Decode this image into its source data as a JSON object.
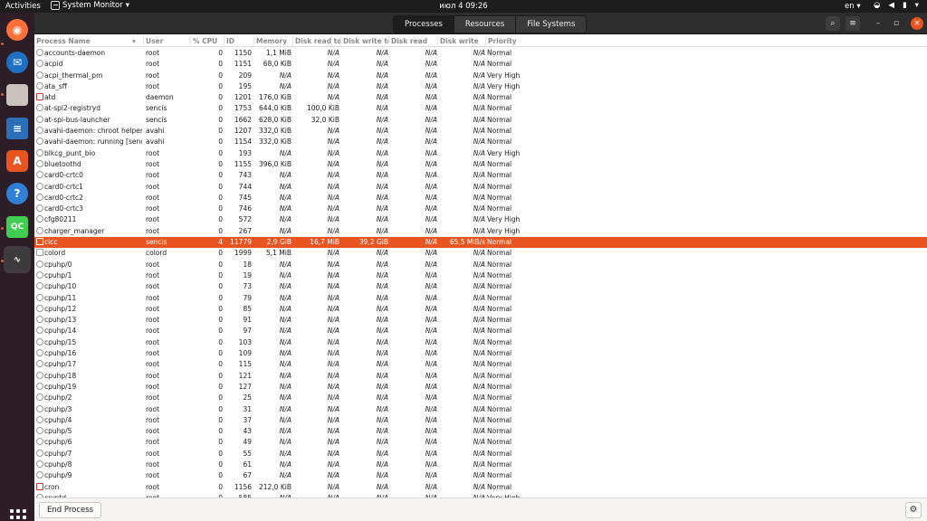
{
  "topbar": {
    "activities": "Activities",
    "app_name": "System Monitor",
    "clock": "июл 4  09:26",
    "lang": "en"
  },
  "dock": {
    "items": [
      {
        "name": "firefox",
        "icon": "firefox-icon",
        "color": "#ff7139"
      },
      {
        "name": "thunderbird",
        "icon": "thunderbird-icon",
        "color": "#1f6fc5"
      },
      {
        "name": "files",
        "icon": "folder-icon",
        "color": "#c9c3bb"
      },
      {
        "name": "writer",
        "icon": "document-icon",
        "color": "#2a6fb8"
      },
      {
        "name": "software",
        "icon": "software-icon",
        "color": "#e95420"
      },
      {
        "name": "help",
        "icon": "help-icon",
        "color": "#2f7fd6"
      },
      {
        "name": "qtcreator",
        "icon": "qc-icon",
        "color": "#41cd52"
      },
      {
        "name": "system-monitor",
        "icon": "monitor-icon",
        "color": "#3b3b3b"
      }
    ]
  },
  "tabs": [
    {
      "label": "Processes",
      "active": true
    },
    {
      "label": "Resources",
      "active": false
    },
    {
      "label": "File Systems",
      "active": false
    }
  ],
  "columns": [
    "Process Name",
    "User",
    "% CPU",
    "ID",
    "Memory",
    "Disk read tota",
    "Disk write tot",
    "Disk read",
    "Disk write",
    "Priority"
  ],
  "accent_color": "#e95420",
  "rows": [
    {
      "name": "accounts-daemon",
      "icon": "gear",
      "user": "root",
      "cpu": "0",
      "id": "1150",
      "mem": "1,1 MiB",
      "drt": "N/A",
      "dwt": "N/A",
      "dr": "N/A",
      "dw": "N/A",
      "prio": "Normal"
    },
    {
      "name": "acpid",
      "icon": "gear",
      "user": "root",
      "cpu": "0",
      "id": "1151",
      "mem": "68,0 KiB",
      "drt": "N/A",
      "dwt": "N/A",
      "dr": "N/A",
      "dw": "N/A",
      "prio": "Normal"
    },
    {
      "name": "acpi_thermal_pm",
      "icon": "gear",
      "user": "root",
      "cpu": "0",
      "id": "209",
      "mem": "N/A",
      "drt": "N/A",
      "dwt": "N/A",
      "dr": "N/A",
      "dw": "N/A",
      "prio": "Very High"
    },
    {
      "name": "ata_sff",
      "icon": "gear",
      "user": "root",
      "cpu": "0",
      "id": "195",
      "mem": "N/A",
      "drt": "N/A",
      "dwt": "N/A",
      "dr": "N/A",
      "dw": "N/A",
      "prio": "Very High"
    },
    {
      "name": "atd",
      "icon": "clock",
      "user": "daemon",
      "cpu": "0",
      "id": "1201",
      "mem": "176,0 KiB",
      "drt": "N/A",
      "dwt": "N/A",
      "dr": "N/A",
      "dw": "N/A",
      "prio": "Normal"
    },
    {
      "name": "at-spi2-registryd",
      "icon": "gear",
      "user": "sencis",
      "cpu": "0",
      "id": "1753",
      "mem": "644,0 KiB",
      "drt": "100,0 KiB",
      "dwt": "N/A",
      "dr": "N/A",
      "dw": "N/A",
      "prio": "Normal"
    },
    {
      "name": "at-spi-bus-launcher",
      "icon": "gear",
      "user": "sencis",
      "cpu": "0",
      "id": "1662",
      "mem": "628,0 KiB",
      "drt": "32,0 KiB",
      "dwt": "N/A",
      "dr": "N/A",
      "dw": "N/A",
      "prio": "Normal"
    },
    {
      "name": "avahi-daemon: chroot helper",
      "icon": "gear",
      "user": "avahi",
      "cpu": "0",
      "id": "1207",
      "mem": "332,0 KiB",
      "drt": "N/A",
      "dwt": "N/A",
      "dr": "N/A",
      "dw": "N/A",
      "prio": "Normal"
    },
    {
      "name": "avahi-daemon: running [sencis-",
      "icon": "gear",
      "user": "avahi",
      "cpu": "0",
      "id": "1154",
      "mem": "332,0 KiB",
      "drt": "N/A",
      "dwt": "N/A",
      "dr": "N/A",
      "dw": "N/A",
      "prio": "Normal"
    },
    {
      "name": "blkcg_punt_bio",
      "icon": "gear",
      "user": "root",
      "cpu": "0",
      "id": "193",
      "mem": "N/A",
      "drt": "N/A",
      "dwt": "N/A",
      "dr": "N/A",
      "dw": "N/A",
      "prio": "Very High"
    },
    {
      "name": "bluetoothd",
      "icon": "gear",
      "user": "root",
      "cpu": "0",
      "id": "1155",
      "mem": "396,0 KiB",
      "drt": "N/A",
      "dwt": "N/A",
      "dr": "N/A",
      "dw": "N/A",
      "prio": "Normal"
    },
    {
      "name": "card0-crtc0",
      "icon": "gear",
      "user": "root",
      "cpu": "0",
      "id": "743",
      "mem": "N/A",
      "drt": "N/A",
      "dwt": "N/A",
      "dr": "N/A",
      "dw": "N/A",
      "prio": "Normal"
    },
    {
      "name": "card0-crtc1",
      "icon": "gear",
      "user": "root",
      "cpu": "0",
      "id": "744",
      "mem": "N/A",
      "drt": "N/A",
      "dwt": "N/A",
      "dr": "N/A",
      "dw": "N/A",
      "prio": "Normal"
    },
    {
      "name": "card0-crtc2",
      "icon": "gear",
      "user": "root",
      "cpu": "0",
      "id": "745",
      "mem": "N/A",
      "drt": "N/A",
      "dwt": "N/A",
      "dr": "N/A",
      "dw": "N/A",
      "prio": "Normal"
    },
    {
      "name": "card0-crtc3",
      "icon": "gear",
      "user": "root",
      "cpu": "0",
      "id": "746",
      "mem": "N/A",
      "drt": "N/A",
      "dwt": "N/A",
      "dr": "N/A",
      "dw": "N/A",
      "prio": "Normal"
    },
    {
      "name": "cfg80211",
      "icon": "gear",
      "user": "root",
      "cpu": "0",
      "id": "572",
      "mem": "N/A",
      "drt": "N/A",
      "dwt": "N/A",
      "dr": "N/A",
      "dw": "N/A",
      "prio": "Very High"
    },
    {
      "name": "charger_manager",
      "icon": "gear",
      "user": "root",
      "cpu": "0",
      "id": "267",
      "mem": "N/A",
      "drt": "N/A",
      "dwt": "N/A",
      "dr": "N/A",
      "dw": "N/A",
      "prio": "Very High"
    },
    {
      "name": "cicc",
      "icon": "doc",
      "user": "sencis",
      "cpu": "4",
      "id": "11779",
      "mem": "2,9 GiB",
      "drt": "16,7 MiB",
      "dwt": "39,2 GiB",
      "dr": "N/A",
      "dw": "65,5 MiB/s",
      "prio": "Normal",
      "selected": true
    },
    {
      "name": "colord",
      "icon": "doc",
      "user": "colord",
      "cpu": "0",
      "id": "1999",
      "mem": "5,1 MiB",
      "drt": "N/A",
      "dwt": "N/A",
      "dr": "N/A",
      "dw": "N/A",
      "prio": "Normal"
    },
    {
      "name": "cpuhp/0",
      "icon": "gear",
      "user": "root",
      "cpu": "0",
      "id": "18",
      "mem": "N/A",
      "drt": "N/A",
      "dwt": "N/A",
      "dr": "N/A",
      "dw": "N/A",
      "prio": "Normal"
    },
    {
      "name": "cpuhp/1",
      "icon": "gear",
      "user": "root",
      "cpu": "0",
      "id": "19",
      "mem": "N/A",
      "drt": "N/A",
      "dwt": "N/A",
      "dr": "N/A",
      "dw": "N/A",
      "prio": "Normal"
    },
    {
      "name": "cpuhp/10",
      "icon": "gear",
      "user": "root",
      "cpu": "0",
      "id": "73",
      "mem": "N/A",
      "drt": "N/A",
      "dwt": "N/A",
      "dr": "N/A",
      "dw": "N/A",
      "prio": "Normal"
    },
    {
      "name": "cpuhp/11",
      "icon": "gear",
      "user": "root",
      "cpu": "0",
      "id": "79",
      "mem": "N/A",
      "drt": "N/A",
      "dwt": "N/A",
      "dr": "N/A",
      "dw": "N/A",
      "prio": "Normal"
    },
    {
      "name": "cpuhp/12",
      "icon": "gear",
      "user": "root",
      "cpu": "0",
      "id": "85",
      "mem": "N/A",
      "drt": "N/A",
      "dwt": "N/A",
      "dr": "N/A",
      "dw": "N/A",
      "prio": "Normal"
    },
    {
      "name": "cpuhp/13",
      "icon": "gear",
      "user": "root",
      "cpu": "0",
      "id": "91",
      "mem": "N/A",
      "drt": "N/A",
      "dwt": "N/A",
      "dr": "N/A",
      "dw": "N/A",
      "prio": "Normal"
    },
    {
      "name": "cpuhp/14",
      "icon": "gear",
      "user": "root",
      "cpu": "0",
      "id": "97",
      "mem": "N/A",
      "drt": "N/A",
      "dwt": "N/A",
      "dr": "N/A",
      "dw": "N/A",
      "prio": "Normal"
    },
    {
      "name": "cpuhp/15",
      "icon": "gear",
      "user": "root",
      "cpu": "0",
      "id": "103",
      "mem": "N/A",
      "drt": "N/A",
      "dwt": "N/A",
      "dr": "N/A",
      "dw": "N/A",
      "prio": "Normal"
    },
    {
      "name": "cpuhp/16",
      "icon": "gear",
      "user": "root",
      "cpu": "0",
      "id": "109",
      "mem": "N/A",
      "drt": "N/A",
      "dwt": "N/A",
      "dr": "N/A",
      "dw": "N/A",
      "prio": "Normal"
    },
    {
      "name": "cpuhp/17",
      "icon": "gear",
      "user": "root",
      "cpu": "0",
      "id": "115",
      "mem": "N/A",
      "drt": "N/A",
      "dwt": "N/A",
      "dr": "N/A",
      "dw": "N/A",
      "prio": "Normal"
    },
    {
      "name": "cpuhp/18",
      "icon": "gear",
      "user": "root",
      "cpu": "0",
      "id": "121",
      "mem": "N/A",
      "drt": "N/A",
      "dwt": "N/A",
      "dr": "N/A",
      "dw": "N/A",
      "prio": "Normal"
    },
    {
      "name": "cpuhp/19",
      "icon": "gear",
      "user": "root",
      "cpu": "0",
      "id": "127",
      "mem": "N/A",
      "drt": "N/A",
      "dwt": "N/A",
      "dr": "N/A",
      "dw": "N/A",
      "prio": "Normal"
    },
    {
      "name": "cpuhp/2",
      "icon": "gear",
      "user": "root",
      "cpu": "0",
      "id": "25",
      "mem": "N/A",
      "drt": "N/A",
      "dwt": "N/A",
      "dr": "N/A",
      "dw": "N/A",
      "prio": "Normal"
    },
    {
      "name": "cpuhp/3",
      "icon": "gear",
      "user": "root",
      "cpu": "0",
      "id": "31",
      "mem": "N/A",
      "drt": "N/A",
      "dwt": "N/A",
      "dr": "N/A",
      "dw": "N/A",
      "prio": "Normal"
    },
    {
      "name": "cpuhp/4",
      "icon": "gear",
      "user": "root",
      "cpu": "0",
      "id": "37",
      "mem": "N/A",
      "drt": "N/A",
      "dwt": "N/A",
      "dr": "N/A",
      "dw": "N/A",
      "prio": "Normal"
    },
    {
      "name": "cpuhp/5",
      "icon": "gear",
      "user": "root",
      "cpu": "0",
      "id": "43",
      "mem": "N/A",
      "drt": "N/A",
      "dwt": "N/A",
      "dr": "N/A",
      "dw": "N/A",
      "prio": "Normal"
    },
    {
      "name": "cpuhp/6",
      "icon": "gear",
      "user": "root",
      "cpu": "0",
      "id": "49",
      "mem": "N/A",
      "drt": "N/A",
      "dwt": "N/A",
      "dr": "N/A",
      "dw": "N/A",
      "prio": "Normal"
    },
    {
      "name": "cpuhp/7",
      "icon": "gear",
      "user": "root",
      "cpu": "0",
      "id": "55",
      "mem": "N/A",
      "drt": "N/A",
      "dwt": "N/A",
      "dr": "N/A",
      "dw": "N/A",
      "prio": "Normal"
    },
    {
      "name": "cpuhp/8",
      "icon": "gear",
      "user": "root",
      "cpu": "0",
      "id": "61",
      "mem": "N/A",
      "drt": "N/A",
      "dwt": "N/A",
      "dr": "N/A",
      "dw": "N/A",
      "prio": "Normal"
    },
    {
      "name": "cpuhp/9",
      "icon": "gear",
      "user": "root",
      "cpu": "0",
      "id": "67",
      "mem": "N/A",
      "drt": "N/A",
      "dwt": "N/A",
      "dr": "N/A",
      "dw": "N/A",
      "prio": "Normal"
    },
    {
      "name": "cron",
      "icon": "clock",
      "user": "root",
      "cpu": "0",
      "id": "1156",
      "mem": "212,0 KiB",
      "drt": "N/A",
      "dwt": "N/A",
      "dr": "N/A",
      "dw": "N/A",
      "prio": "Normal"
    },
    {
      "name": "cryptd",
      "icon": "gear",
      "user": "root",
      "cpu": "0",
      "id": "585",
      "mem": "N/A",
      "drt": "N/A",
      "dwt": "N/A",
      "dr": "N/A",
      "dw": "N/A",
      "prio": "Very High"
    }
  ],
  "bottombar": {
    "end_process": "End Process"
  }
}
